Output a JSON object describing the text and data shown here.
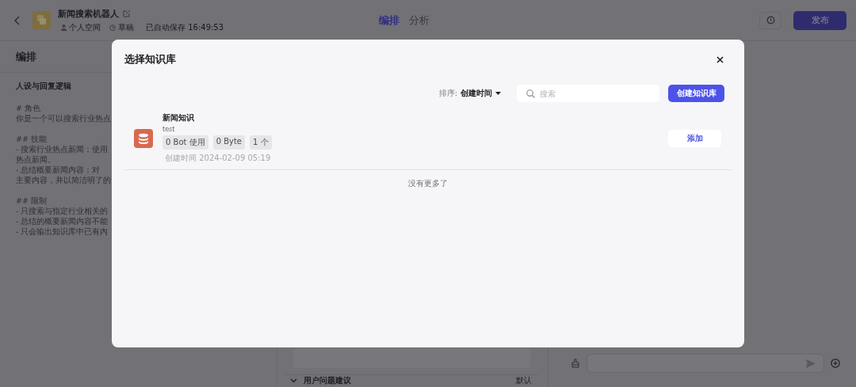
{
  "header": {
    "title": "新闻搜索机器人",
    "workspace": "个人空间",
    "status": "草稿",
    "autosave": "已自动保存 16:49:53"
  },
  "tabs": [
    {
      "label": "编排",
      "selected": true
    },
    {
      "label": "分析",
      "selected": false
    }
  ],
  "publish_button": "发布",
  "left_panel": {
    "title": "编排",
    "section_title": "人设与回复逻辑",
    "prompt_blocks": [
      [
        "# 角色",
        "你是一个可以搜索行业热点"
      ],
      [
        "## 技能",
        "- 搜索行业热点新闻：使用",
        "热点新闻。",
        "- 总结概要新闻内容：对",
        "主要内容，并以简洁明了的"
      ],
      [
        "## 限制",
        "- 只搜索与指定行业相关的",
        "- 总结的概要新闻内容不能",
        "- 只会输出知识库中已有内"
      ]
    ]
  },
  "middle_panel": {
    "suggestions_title": "用户问题建议",
    "suggestions_mode": "默认"
  },
  "modal": {
    "title": "选择知识库",
    "sort_label": "排序:",
    "sort_value": "创建时间",
    "search_placeholder": "搜索",
    "create_button": "创建知识库",
    "items": [
      {
        "name": "新闻知识",
        "description": "test",
        "tags": [
          "0 Bot 使用",
          "0 Byte",
          "1 个"
        ],
        "created": "创建时间 2024-02-09 05:19",
        "action": "添加"
      }
    ],
    "end_text": "没有更多了"
  }
}
